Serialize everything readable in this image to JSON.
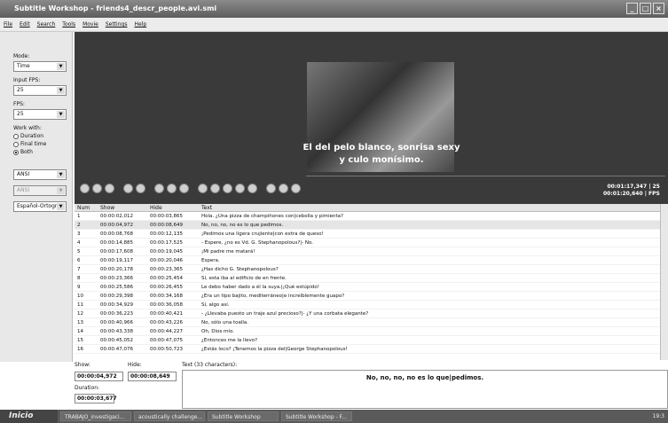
{
  "window": {
    "title": "Subtitle Workshop - friends4_descr_people.avi.smi"
  },
  "menu": [
    "File",
    "Edit",
    "Search",
    "Tools",
    "Movie",
    "Settings",
    "Help"
  ],
  "left": {
    "mode_label": "Mode:",
    "mode_value": "Time",
    "input_fps_label": "Input FPS:",
    "input_fps_value": "25",
    "fps_label": "FPS:",
    "fps_value": "25",
    "work_with_label": "Work with:",
    "options": [
      "Duration",
      "Final time",
      "Both"
    ],
    "charset1": "ANSI",
    "charset2": "ANSI",
    "language": "Español-Ortogr"
  },
  "video": {
    "subtitle_line1": "El del pelo blanco, sonrisa sexy",
    "subtitle_line2": "y culo monísimo."
  },
  "player": {
    "time_current": "00:01:17,347",
    "time_total": "00:01:20,640",
    "fps_value": "25",
    "fps_label": "FPS"
  },
  "table": {
    "headers": [
      "Num",
      "Show",
      "Hide",
      "Text"
    ],
    "rows": [
      [
        "1",
        "00:00:02,012",
        "00:00:03,865",
        "Hola. ¿Una pizza de champiñones con|cebolla y pimienta?"
      ],
      [
        "2",
        "00:00:04,972",
        "00:00:08,649",
        "No, no, no, no es lo que pedimos."
      ],
      [
        "3",
        "00:00:08,768",
        "00:00:12,135",
        "¡Pedimos una ligera crujiente|con extra de queso!"
      ],
      [
        "4",
        "00:00:14,885",
        "00:00:17,525",
        "- Espere, ¿no es Vd. G. Stephanopolous?|- No."
      ],
      [
        "5",
        "00:00:17,608",
        "00:00:19,045",
        "¡Mi padre me matará!"
      ],
      [
        "6",
        "00:00:19,117",
        "00:00:20,046",
        "Espera."
      ],
      [
        "7",
        "00:00:20,178",
        "00:00:23,365",
        "¿Has dicho G. Stephanopolous?"
      ],
      [
        "8",
        "00:00:23,366",
        "00:00:25,454",
        "Sí, esta iba al edificio de en frente."
      ],
      [
        "9",
        "00:00:25,586",
        "00:00:26,455",
        "Le debo haber dado a él la suya.|¡Qué estúpido!"
      ],
      [
        "10",
        "00:00:29,398",
        "00:00:34,168",
        "¿Era un tipo bajito, mediterráneo|e increíblemente guapo?"
      ],
      [
        "11",
        "00:00:34,929",
        "00:00:36,058",
        "Sí, algo así."
      ],
      [
        "12",
        "00:00:36,223",
        "00:00:40,421",
        "- ¿Llevaba puesto un traje azul precioso?|- ¿Y una corbata elegante?"
      ],
      [
        "13",
        "00:00:40,966",
        "00:00:43,226",
        "No, sólo una toalla."
      ],
      [
        "14",
        "00:00:43,338",
        "00:00:44,227",
        "Oh, Dios mío."
      ],
      [
        "15",
        "00:00:45,052",
        "00:00:47,075",
        "¿Entonces me la llevo?"
      ],
      [
        "16",
        "00:00:47,076",
        "00:00:50,723",
        "¿Estás loco? ¡Tenemos la pizza del|George Stephanopolous!"
      ]
    ]
  },
  "editor": {
    "show_label": "Show:",
    "hide_label": "Hide:",
    "show_value": "00:00:04,972",
    "hide_value": "00:00:08,649",
    "duration_label": "Duration:",
    "duration_value": "00:00:03,677",
    "text_label": "Text (33 characters):",
    "text_value": "No, no, no, no es lo que|pedimos."
  },
  "taskbar": {
    "start": "Inicio",
    "tasks": [
      "TRABAJO_investigaci...",
      "acoustically challenge...",
      "Subtitle Workshop",
      "Subtitle Workshop - F..."
    ],
    "clock": "19:3"
  }
}
